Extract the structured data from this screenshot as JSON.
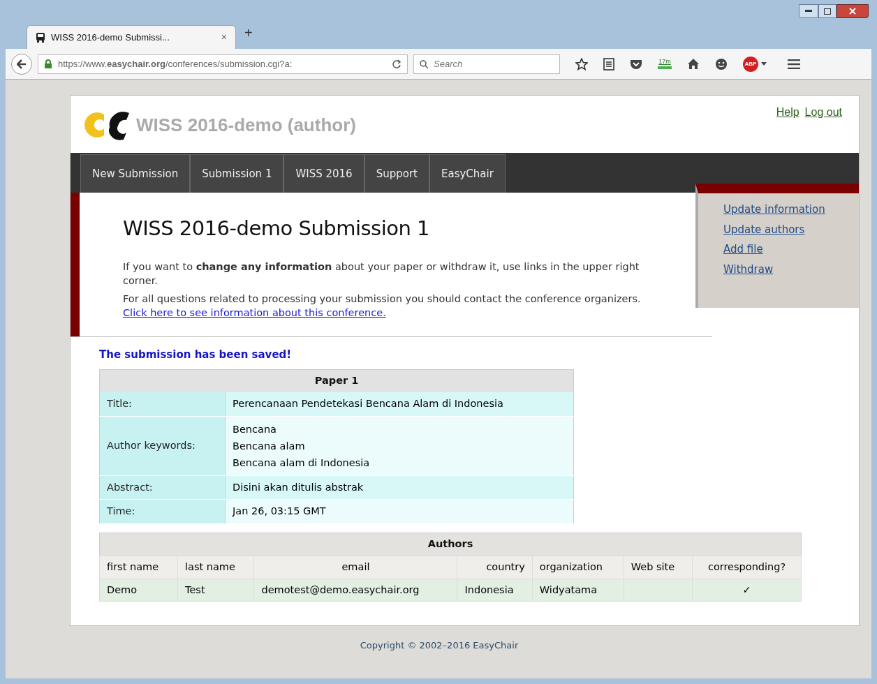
{
  "browser": {
    "tab_title": "WISS 2016-demo Submissi...",
    "tab_close": "×",
    "new_tab": "+",
    "url": "https://www.**easychair.org**/conferences/submission.cgi?a:",
    "search_placeholder": "Search",
    "timer_badge": "17m",
    "adblock_label": "ABP"
  },
  "header": {
    "title": "WISS 2016-demo (author)",
    "links": [
      "Help",
      "Log out"
    ]
  },
  "menu": [
    {
      "label": "New Submission"
    },
    {
      "label": "Submission 1"
    },
    {
      "label": "WISS 2016"
    },
    {
      "label": "Support"
    },
    {
      "label": "EasyChair"
    }
  ],
  "side_links": [
    "Update information",
    "Update authors",
    "Add file",
    "Withdraw"
  ],
  "heading": "WISS 2016-demo Submission 1",
  "intro": "If you want to **change any information** about your paper or withdraw it, use links in the upper right corner.",
  "contact_text": "For all questions related to processing your submission you should contact the conference organizers.",
  "contact_link": "Click here to see information about this conference.",
  "saved_message": "The submission has been saved!",
  "paper_table": {
    "title": "Paper 1",
    "rows": [
      {
        "label": "Title:",
        "values": [
          "Perencanaan Pendetekasi Bencana Alam di Indonesia"
        ]
      },
      {
        "label": "Author keywords:",
        "values": [
          "Bencana",
          "Bencana alam",
          "Bencana alam di Indonesia"
        ]
      },
      {
        "label": "Abstract:",
        "values": [
          "Disini akan ditulis abstrak"
        ]
      },
      {
        "label": "Time:",
        "values": [
          "Jan 26, 03:15 GMT"
        ]
      }
    ]
  },
  "authors_table": {
    "title": "Authors",
    "columns": [
      "first name",
      "last name",
      "email",
      "country",
      "organization",
      "Web site",
      "corresponding?"
    ],
    "rows": [
      [
        "Demo",
        "Test",
        "demotest@demo.easychair.org",
        "Indonesia",
        "Widyatama",
        "",
        "✓"
      ]
    ]
  },
  "footer": "Copyright © 2002–2016 EasyChair"
}
